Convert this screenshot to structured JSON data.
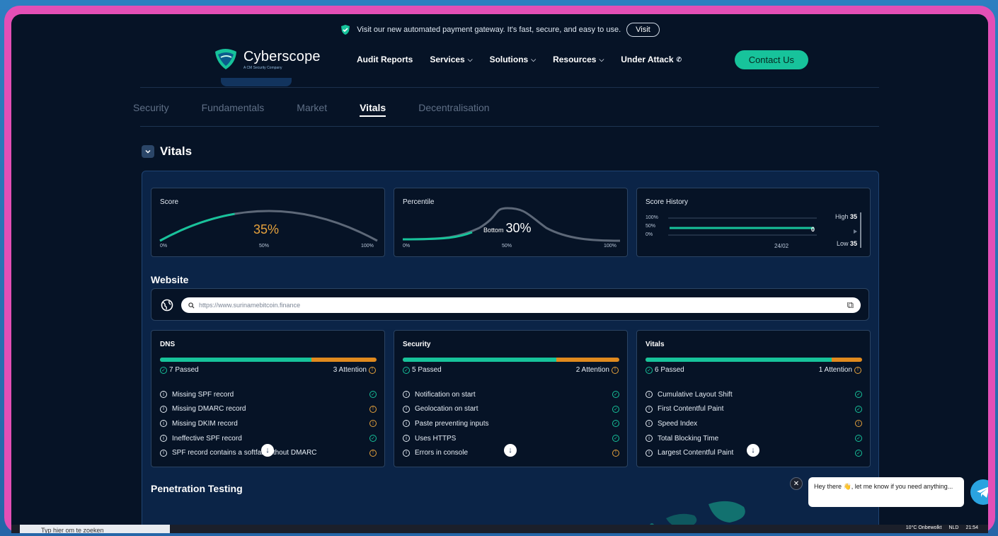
{
  "announcement": {
    "text": "Visit our new automated payment gateway. It's fast, secure, and easy to use.",
    "button": "Visit"
  },
  "brand": {
    "name": "Cyberscope",
    "tagline": "A CM Security Company"
  },
  "nav": {
    "items": [
      "Audit Reports",
      "Services",
      "Solutions",
      "Resources",
      "Under Attack"
    ],
    "contact": "Contact Us"
  },
  "tabs": [
    {
      "label": "Security",
      "active": false
    },
    {
      "label": "Fundamentals",
      "active": false
    },
    {
      "label": "Market",
      "active": false
    },
    {
      "label": "Vitals",
      "active": true
    },
    {
      "label": "Decentralisation",
      "active": false
    }
  ],
  "section_title": "Vitals",
  "score": {
    "label": "Score",
    "value": "35%",
    "fraction": 0.35,
    "ticks": [
      "0%",
      "50%",
      "100%"
    ]
  },
  "percentile": {
    "label": "Percentile",
    "prefix": "Bottom",
    "value": "30%",
    "ticks": [
      "0%",
      "50%",
      "100%"
    ]
  },
  "history": {
    "label": "Score History",
    "y_ticks": [
      "100%",
      "50%",
      "0%"
    ],
    "high_label": "High",
    "high_value": "35",
    "current": "0",
    "low_label": "Low",
    "low_value": "35",
    "date": "24/02"
  },
  "website": {
    "title": "Website",
    "url": "https://www.surinamebitcoin.finance"
  },
  "checks": [
    {
      "title": "DNS",
      "passed": "7 Passed",
      "attention": "3 Attention",
      "pass_fraction": 0.7,
      "items": [
        {
          "name": "Missing SPF record",
          "status": "ok"
        },
        {
          "name": "Missing DMARC record",
          "status": "warn"
        },
        {
          "name": "Missing DKIM record",
          "status": "warn"
        },
        {
          "name": "Ineffective SPF record",
          "status": "ok"
        },
        {
          "name": "SPF record contains a softfail without DMARC",
          "status": "warn"
        }
      ]
    },
    {
      "title": "Security",
      "passed": "5 Passed",
      "attention": "2 Attention",
      "pass_fraction": 0.71,
      "items": [
        {
          "name": "Notification on start",
          "status": "ok"
        },
        {
          "name": "Geolocation on start",
          "status": "ok"
        },
        {
          "name": "Paste preventing inputs",
          "status": "ok"
        },
        {
          "name": "Uses HTTPS",
          "status": "ok"
        },
        {
          "name": "Errors in console",
          "status": "warn"
        }
      ]
    },
    {
      "title": "Vitals",
      "passed": "6 Passed",
      "attention": "1 Attention",
      "pass_fraction": 0.86,
      "items": [
        {
          "name": "Cumulative Layout Shift",
          "status": "ok"
        },
        {
          "name": "First Contentful Paint",
          "status": "ok"
        },
        {
          "name": "Speed Index",
          "status": "warn"
        },
        {
          "name": "Total Blocking Time",
          "status": "ok"
        },
        {
          "name": "Largest Contentful Paint",
          "status": "ok"
        }
      ]
    }
  ],
  "pentest_title": "Penetration Testing",
  "chat": {
    "message": "Hey there 👋, let me know if you need anything..."
  },
  "taskbar": {
    "search": "Typ hier om te zoeken",
    "weather": "10°C Onbewolkt",
    "lang": "NLD",
    "time": "21:54"
  },
  "colors": {
    "accent": "#17c39b",
    "warning": "#e6a23c",
    "panel": "#0b2447",
    "bg": "#061326",
    "frame": "#e34fb6"
  }
}
